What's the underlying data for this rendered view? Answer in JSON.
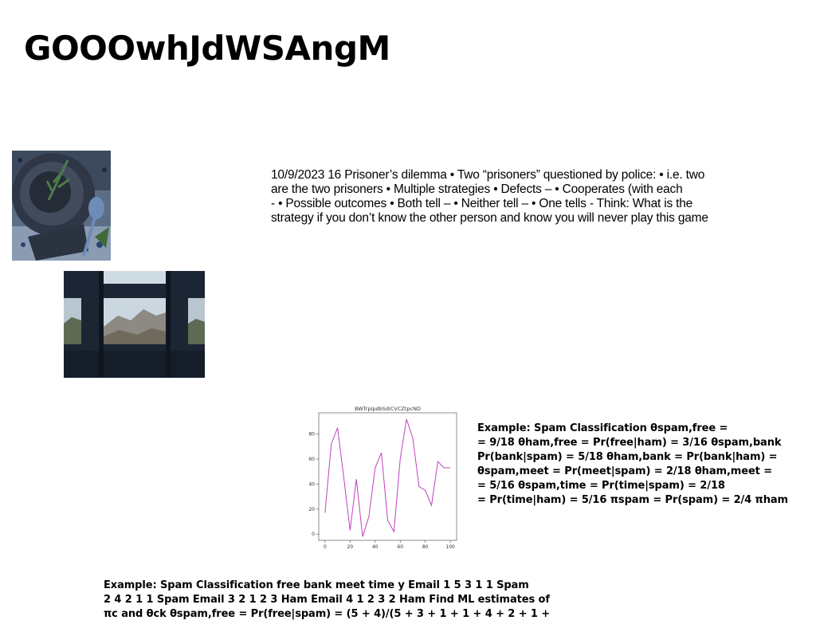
{
  "title": "GOOOwhJdWSAngM",
  "paragraph": "10/9/2023 16 Prisoner’s dilemma • Two “prisoners” questioned by police: • i.e. two\nare the two prisoners • Multiple strategies • Defects – • Cooperates (with each\n- • Possible outcomes • Both tell – • Neither tell – • One tells - Think: What is the\nstrategy if you don’t know the other person and know you will never play this game",
  "example_right": "Example: Spam Classification θspam,free =\n= 9/18 θham,free = Pr(free|ham) = 3/16 θspam,bank\nPr(bank|spam) = 5/18 θham,bank = Pr(bank|ham) =\nθspam,meet = Pr(meet|spam) = 2/18 θham,meet =\n= 5/16 θspam,time = Pr(time|spam) = 2/18\n= Pr(time|ham) = 5/16 πspam = Pr(spam) = 2/4 πham",
  "example_bottom": "Example: Spam Classification free bank meet time y Email 1 5 3 1 1 Spam\n2 4 2 1 1 Spam Email 3 2 1 2 3 Ham Email 4 1 2 3 2 Ham Find ML estimates of\nπc and θck θspam,free = Pr(free|spam) = (5 + 4)/(5 + 3 + 1 + 1 + 4 + 2 + 1 +",
  "chart_data": {
    "type": "line",
    "title": "BWTrpIpdbSdiCVCZtpcND",
    "x": [
      0,
      5,
      10,
      15,
      20,
      25,
      30,
      35,
      40,
      45,
      50,
      55,
      60,
      65,
      70,
      75,
      80,
      85,
      90,
      95,
      100
    ],
    "series": [
      {
        "values": [
          17,
          72,
          85,
          45,
          3,
          44,
          -2,
          14,
          53,
          65,
          11,
          2,
          60,
          92,
          77,
          38,
          35,
          23,
          58,
          53,
          53
        ]
      }
    ],
    "xlim": [
      -5,
      105
    ],
    "ylim": [
      -5,
      97
    ],
    "xticks": [
      "0",
      "20",
      "40",
      "60",
      "80",
      "100"
    ],
    "yticks": [
      "0",
      "20",
      "40",
      "60",
      "80"
    ],
    "color": "#c040c0"
  }
}
